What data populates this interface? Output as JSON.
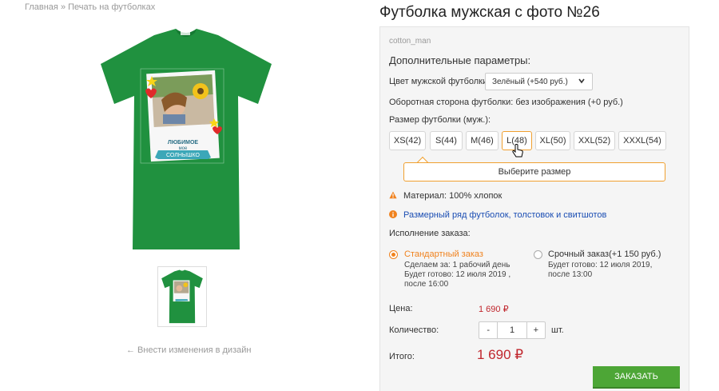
{
  "breadcrumb": {
    "home": "Главная",
    "separator": "»",
    "current": "Печать на футболках"
  },
  "product": {
    "title": "Футболка мужская с фото №26",
    "sku": "cotton_man",
    "print_caption_1": "ЛЮБИМОЕ",
    "print_caption_2": "мое",
    "print_caption_3": "СОЛНЫШКО",
    "tshirt_color": "#20913f"
  },
  "gallery": {
    "edit_link": "← Внести изменения в дизайн"
  },
  "options": {
    "title": "Дополнительные параметры:",
    "color_label": "Цвет мужской футболки",
    "color_value": "Зелёный (+540 руб.)",
    "back_side": "Оборотная сторона футболки: без изображения (+0 руб.)",
    "size_label": "Размер футболки (муж.):",
    "sizes": [
      "XS(42)",
      "S(44)",
      "M(46)",
      "L(48)",
      "XL(50)",
      "XXL(52)",
      "XXXL(54)"
    ],
    "size_hint": "Выберите размер"
  },
  "info": {
    "material": "Материал: 100% хлопок",
    "size_chart_link": "Размерный ряд футболок, толстовок и свитшотов"
  },
  "fulfillment": {
    "label": "Исполнение заказа:",
    "standard": {
      "title": "Стандартный заказ",
      "line1": "Сделаем за: 1 рабочий день",
      "line2": "Будет готово: 12 июля 2019 ,",
      "line3": "после 16:00"
    },
    "urgent": {
      "title": "Срочный заказ(+1 150 руб.)",
      "line1": "Будет готово: 12 июля 2019,",
      "line2": "после 13:00"
    }
  },
  "pricing": {
    "price_label": "Цена:",
    "price_value": "1 690 ₽",
    "qty_label": "Количество:",
    "qty_minus": "-",
    "qty_value": "1",
    "qty_plus": "+",
    "qty_unit": "шт.",
    "total_label": "Итого:",
    "total_value": "1 690 ₽"
  },
  "actions": {
    "order_button": "ЗАКАЗАТЬ"
  },
  "colors": {
    "accent_orange": "#f0821e",
    "price_red": "#c0262d",
    "order_green": "#4da636",
    "link_blue": "#1a4db3"
  }
}
